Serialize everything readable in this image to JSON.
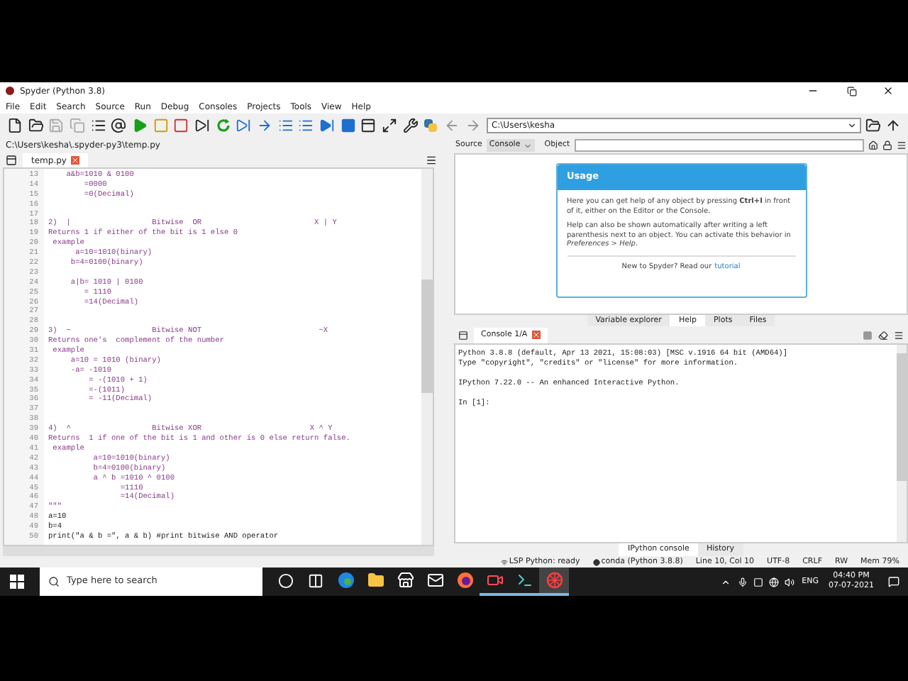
{
  "window": {
    "title": "Spyder (Python 3.8)"
  },
  "menu": [
    "File",
    "Edit",
    "Search",
    "Source",
    "Run",
    "Debug",
    "Consoles",
    "Projects",
    "Tools",
    "View",
    "Help"
  ],
  "toolbar": {
    "path": "C:\\Users\\kesha"
  },
  "editor": {
    "file_path": "C:\\Users\\kesha\\.spyder-py3\\temp.py",
    "tabs": [
      {
        "label": "temp.py",
        "selected": true
      }
    ],
    "lines": [
      {
        "number": "13",
        "kind": "doc",
        "text": "    a&b=1010 & 0100"
      },
      {
        "number": "14",
        "kind": "doc",
        "text": "        =0000"
      },
      {
        "number": "15",
        "kind": "doc",
        "text": "        =0(Decimal)"
      },
      {
        "number": "16"
      },
      {
        "number": "17"
      },
      {
        "number": "18",
        "kind": "doc",
        "text": "2)  |                  Bitwise  OR                         X | Y"
      },
      {
        "number": "19",
        "kind": "doc",
        "text": "Returns 1 if either of the bit is 1 else 0"
      },
      {
        "number": "20",
        "kind": "doc",
        "text": " example"
      },
      {
        "number": "21",
        "kind": "doc",
        "text": "      a=10=1010(binary)"
      },
      {
        "number": "22",
        "kind": "doc",
        "text": "     b=4=0100(binary)"
      },
      {
        "number": "23"
      },
      {
        "number": "24",
        "kind": "doc",
        "text": "     a|b= 1010 | 0100"
      },
      {
        "number": "25",
        "kind": "doc",
        "text": "        = 1110"
      },
      {
        "number": "26",
        "kind": "doc",
        "text": "        =14(Decimal)"
      },
      {
        "number": "27"
      },
      {
        "number": "28"
      },
      {
        "number": "29",
        "kind": "doc",
        "text": "3)  ~                  Bitwise NOT                          ~X"
      },
      {
        "number": "30",
        "kind": "doc",
        "text": "Returns one's  complement of the number"
      },
      {
        "number": "31",
        "kind": "doc",
        "text": " example"
      },
      {
        "number": "32",
        "kind": "doc",
        "text": "     a=10 = 1010 (binary)"
      },
      {
        "number": "33",
        "kind": "doc",
        "text": "     -a= -1010"
      },
      {
        "number": "34",
        "kind": "doc",
        "text": "         = -(1010 + 1)"
      },
      {
        "number": "35",
        "kind": "doc",
        "text": "         =-(1011)"
      },
      {
        "number": "36",
        "kind": "doc",
        "text": "         = -11(Decimal)"
      },
      {
        "number": "37"
      },
      {
        "number": "38"
      },
      {
        "number": "39",
        "kind": "doc",
        "text": "4)  ^                  Bitwise XOR                        X ^ Y"
      },
      {
        "number": "40",
        "kind": "doc",
        "text": "Returns  1 if one of the bit is 1 and other is 0 else return false."
      },
      {
        "number": "41",
        "kind": "doc",
        "text": " example"
      },
      {
        "number": "42",
        "kind": "doc",
        "text": "          a=10=1010(binary)"
      },
      {
        "number": "43",
        "kind": "doc",
        "text": "          b=4=0100(binary)"
      },
      {
        "number": "44",
        "kind": "doc",
        "text": "          a ^ b =1010 ^ 0100"
      },
      {
        "number": "45",
        "kind": "doc",
        "text": "                =1110"
      },
      {
        "number": "46",
        "kind": "doc",
        "text": "                =14(Decimal)"
      },
      {
        "number": "47",
        "kind": "doc",
        "text": "\"\"\""
      },
      {
        "number": "48",
        "kind": "code",
        "text": "a=10"
      },
      {
        "number": "49",
        "kind": "code",
        "text": "b=4"
      },
      {
        "number": "50",
        "kind": "code",
        "text": "print(\"a & b =\", a & b) #print bitwise AND operator"
      }
    ]
  },
  "help": {
    "source_label": "Source",
    "source_value": "Console",
    "object_label": "Object",
    "usage": {
      "title": "Usage",
      "paragraphs": [
        "Here you can get help of any object by pressing **Ctrl+I** in front of it, either on the Editor or the Console.",
        "Help can also be shown automatically after writing a left parenthesis next to an object. You can activate this behavior in *Preferences > Help*."
      ],
      "footer_text": "New to Spyder? Read our",
      "footer_link": "tutorial"
    }
  },
  "help_tabs": [
    {
      "label": "Variable explorer",
      "selected": false
    },
    {
      "label": "Help",
      "selected": true
    },
    {
      "label": "Plots",
      "selected": false
    },
    {
      "label": "Files",
      "selected": false
    }
  ],
  "console": {
    "tabs": [
      {
        "label": "Console 1/A",
        "selected": true
      }
    ],
    "lines": [
      "Python 3.8.8 (default, Apr 13 2021, 15:08:03) [MSC v.1916 64 bit (AMD64)]\nType \"copyright\", \"credits\" or \"license\" for more information.",
      "IPython 7.22.0 -- An enhanced Interactive Python.",
      "In [1]:"
    ]
  },
  "console_tabs": [
    {
      "label": "IPython console",
      "selected": true
    },
    {
      "label": "History",
      "selected": false
    }
  ],
  "status_bar": [
    {
      "kind": "lsp",
      "text": "LSP Python: ready"
    },
    {
      "kind": "conda",
      "text": "conda (Python 3.8.8)"
    },
    {
      "kind": "plain",
      "text": "Line 10, Col 10"
    },
    {
      "kind": "plain",
      "text": "UTF-8"
    },
    {
      "kind": "plain",
      "text": "CRLF"
    },
    {
      "kind": "plain",
      "text": "RW"
    },
    {
      "kind": "plain",
      "text": "Mem 79%"
    }
  ],
  "taskbar": {
    "search_placeholder": "Type here to search",
    "apps": [
      {
        "kind": "cortana",
        "running": false,
        "selected": false
      },
      {
        "kind": "taskview",
        "running": false,
        "selected": false
      },
      {
        "kind": "edge",
        "running": false,
        "selected": false
      },
      {
        "kind": "folder",
        "running": false,
        "selected": false
      },
      {
        "kind": "store",
        "running": false,
        "selected": false
      },
      {
        "kind": "mail",
        "running": false,
        "selected": false
      },
      {
        "kind": "firefox",
        "running": false,
        "selected": false
      },
      {
        "kind": "recorder",
        "running": true,
        "selected": false
      },
      {
        "kind": "terminal",
        "running": true,
        "selected": false
      },
      {
        "kind": "spyder",
        "running": true,
        "selected": true
      }
    ],
    "language": "ENG",
    "time": "04:40 PM",
    "date": "07-07-2021"
  }
}
